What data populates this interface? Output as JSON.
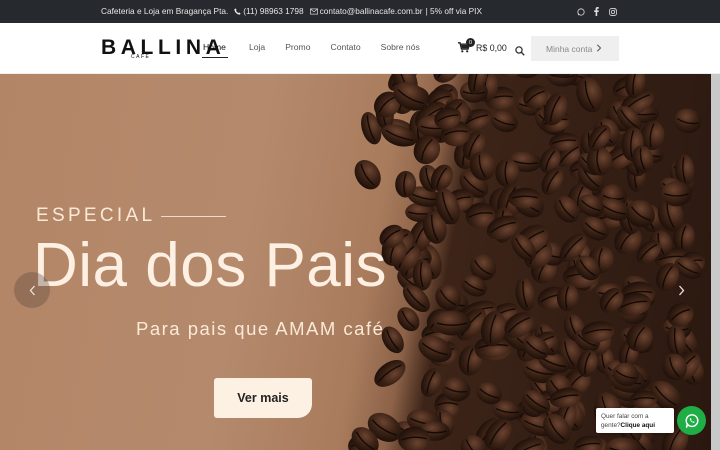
{
  "topbar": {
    "location": "Cafeteria e Loja em Bragança Pta.",
    "phone": "(11) 98963 1798",
    "email": "contato@ballinacafe.com.br",
    "promo": "| 5% off via PIX",
    "social_icons": [
      "whatsapp-icon",
      "facebook-icon",
      "instagram-icon"
    ]
  },
  "logo": {
    "word": "BALLINA",
    "sub": "CAFÉ"
  },
  "nav": {
    "items": [
      {
        "label": "Home",
        "active": true
      },
      {
        "label": "Loja"
      },
      {
        "label": "Promo"
      },
      {
        "label": "Contato"
      },
      {
        "label": "Sobre nós"
      }
    ]
  },
  "cart": {
    "count": "0",
    "total": "R$ 0,00"
  },
  "account": {
    "label": "Minha conta"
  },
  "hero": {
    "eyebrow": "ESPECIAL",
    "title": "Dia dos Pais",
    "subtitle": "Para pais que AMAM café",
    "cta": "Ver mais"
  },
  "chat": {
    "line1": "Quer falar com a",
    "line2_prefix": "gente?",
    "line2_link": "Clique aqui"
  },
  "colors": {
    "topbar": "#26292e",
    "hero_bg": "#b28566",
    "hero_text": "#fdf0e3",
    "whatsapp": "#1fae46"
  }
}
